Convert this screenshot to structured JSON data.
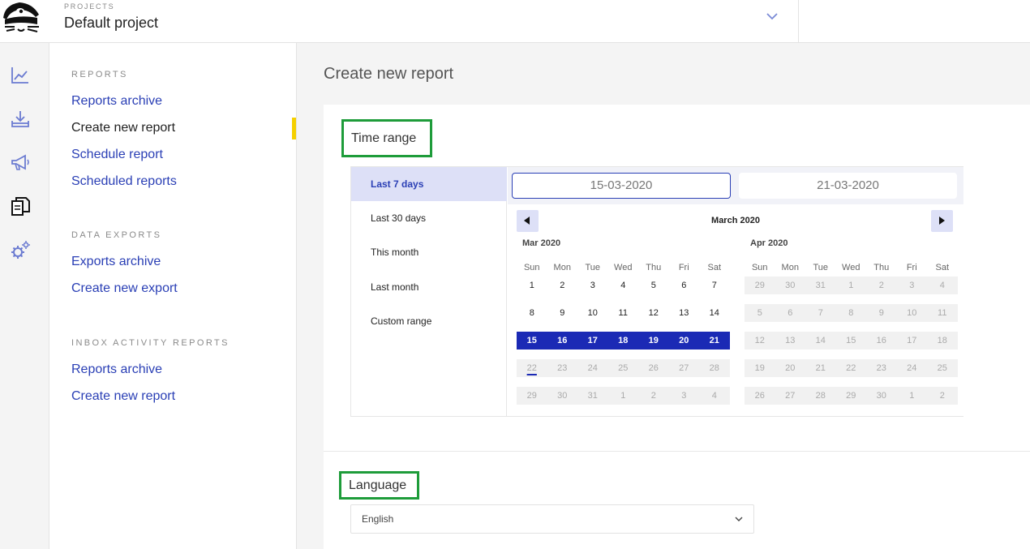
{
  "header": {
    "projects_caption": "PROJECTS",
    "project_name": "Default project"
  },
  "sidebar": {
    "sections": [
      {
        "heading": "REPORTS",
        "links": [
          "Reports archive",
          "Create new report",
          "Schedule report",
          "Scheduled reports"
        ]
      },
      {
        "heading": "DATA EXPORTS",
        "links": [
          "Exports archive",
          "Create new export"
        ]
      },
      {
        "heading": "INBOX ACTIVITY REPORTS",
        "links": [
          "Reports archive",
          "Create new report"
        ]
      }
    ],
    "active_link": "Create new report"
  },
  "rail_icons": [
    "line-chart-icon",
    "download-tray-icon",
    "megaphone-icon",
    "documents-icon",
    "settings-gears-icon"
  ],
  "main": {
    "title": "Create new report",
    "time_range": {
      "label": "Time range",
      "presets": [
        "Last 7 days",
        "Last 30 days",
        "This month",
        "Last month",
        "Custom range"
      ],
      "selected_preset": "Last 7 days",
      "start_date": "15-03-2020",
      "end_date": "21-03-2020",
      "calendar_caption": "March 2020",
      "weekdays": [
        "Sun",
        "Mon",
        "Tue",
        "Wed",
        "Thu",
        "Fri",
        "Sat"
      ],
      "months": [
        {
          "name": "Mar 2020",
          "weeks": [
            [
              "1",
              "2",
              "3",
              "4",
              "5",
              "6",
              "7"
            ],
            [
              "8",
              "9",
              "10",
              "11",
              "12",
              "13",
              "14"
            ],
            [
              "15",
              "16",
              "17",
              "18",
              "19",
              "20",
              "21"
            ],
            [
              "22",
              "23",
              "24",
              "25",
              "26",
              "27",
              "28"
            ],
            [
              "29",
              "30",
              "31",
              "1",
              "2",
              "3",
              "4"
            ]
          ],
          "selected_row": 2,
          "today": "22"
        },
        {
          "name": "Apr 2020",
          "weeks": [
            [
              "29",
              "30",
              "31",
              "1",
              "2",
              "3",
              "4"
            ],
            [
              "5",
              "6",
              "7",
              "8",
              "9",
              "10",
              "11"
            ],
            [
              "12",
              "13",
              "14",
              "15",
              "16",
              "17",
              "18"
            ],
            [
              "19",
              "20",
              "21",
              "22",
              "23",
              "24",
              "25"
            ],
            [
              "26",
              "27",
              "28",
              "29",
              "30",
              "1",
              "2"
            ]
          ]
        }
      ]
    },
    "language": {
      "label": "Language",
      "value": "English"
    }
  },
  "colors": {
    "accent": "#2a3fb5",
    "range_fill": "#1b2ab5",
    "active_marker": "#f5d000",
    "highlight_box": "#1e9c3a"
  }
}
